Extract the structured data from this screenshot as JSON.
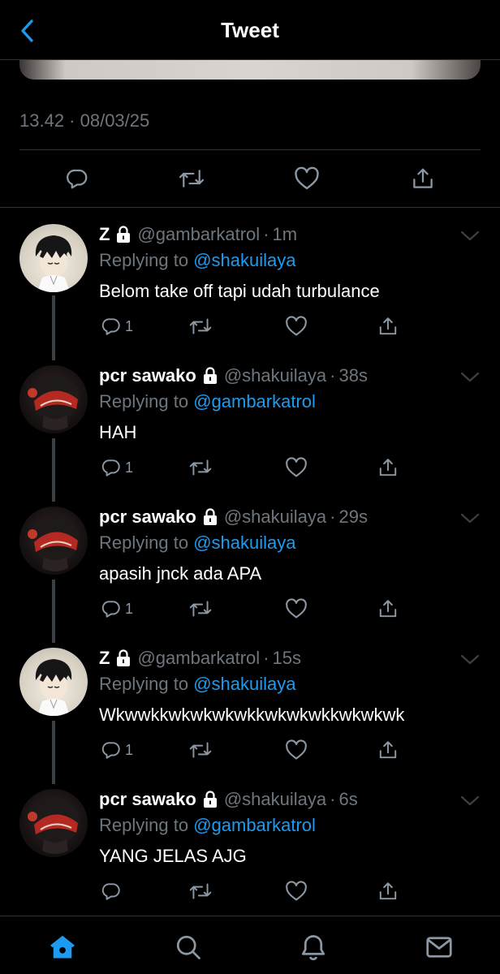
{
  "header": {
    "title": "Tweet",
    "back_icon": "chevron-left-icon"
  },
  "tweet": {
    "timestamp": "13.42 · 08/03/25"
  },
  "main_actions": [
    "reply-icon",
    "retweet-icon",
    "like-icon",
    "share-icon"
  ],
  "replies": [
    {
      "name": "Z",
      "handle": "@gambarkatrol",
      "dot": "·",
      "time": "1m",
      "replying_prefix": "Replying to ",
      "replying_to": "@shakuilaya",
      "text": "Belom take off tapi udah turbulance",
      "reply_count": "1"
    },
    {
      "name": "pcr sawako",
      "handle": "@shakuilaya",
      "dot": "·",
      "time": "38s",
      "replying_prefix": "Replying to ",
      "replying_to": "@gambarkatrol",
      "text": "HAH",
      "reply_count": "1"
    },
    {
      "name": "pcr sawako",
      "handle": "@shakuilaya",
      "dot": "·",
      "time": "29s",
      "replying_prefix": "Replying to ",
      "replying_to": "@shakuilaya",
      "text": "apasih jnck ada APA",
      "reply_count": "1"
    },
    {
      "name": "Z",
      "handle": "@gambarkatrol",
      "dot": "·",
      "time": "15s",
      "replying_prefix": "Replying to ",
      "replying_to": "@shakuilaya",
      "text": "Wkwwkkwkwkwkwkkwkwkwkkwkwkwk",
      "reply_count": "1"
    },
    {
      "name": "pcr sawako",
      "handle": "@shakuilaya",
      "dot": "·",
      "time": "6s",
      "replying_prefix": "Replying to ",
      "replying_to": "@gambarkatrol",
      "text": "YANG JELAS AJG",
      "reply_count": ""
    }
  ],
  "tabs": [
    "home-icon",
    "search-icon",
    "notifications-icon",
    "messages-icon"
  ],
  "colors": {
    "background": "#000000",
    "accent": "#1d9bf0",
    "muted": "#6e767d",
    "divider": "#2f3336"
  }
}
